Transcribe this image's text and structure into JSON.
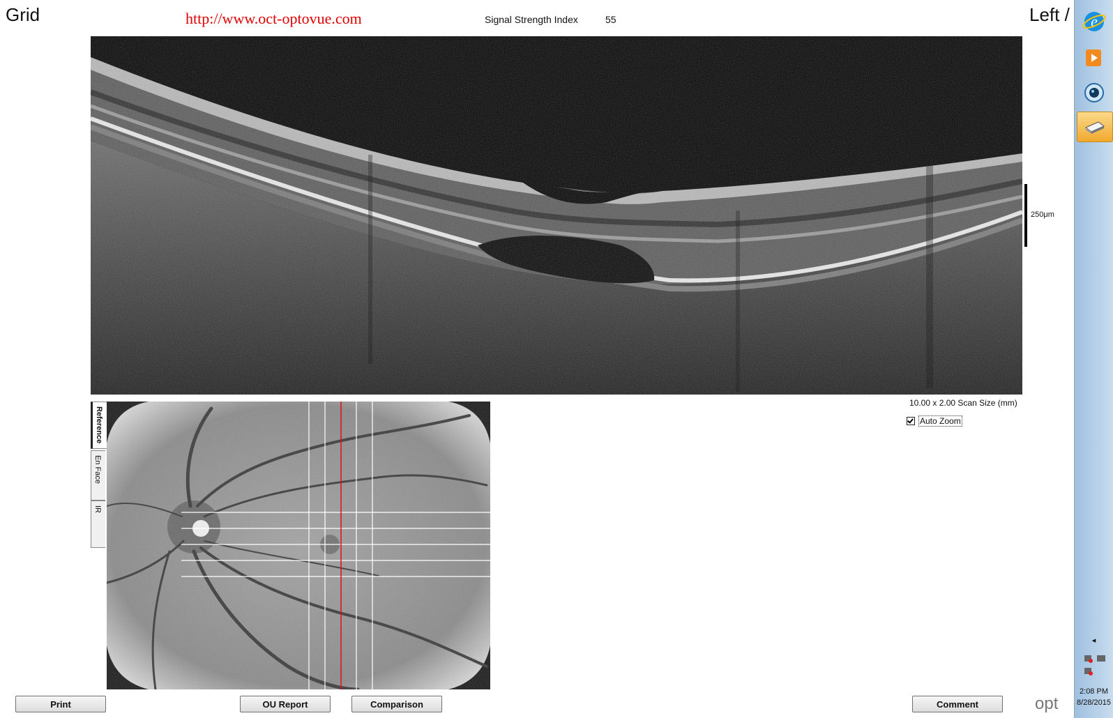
{
  "header": {
    "scan_type": "Grid",
    "watermark_url": "http://www.oct-optovue.com",
    "signal_strength_label": "Signal Strength Index",
    "signal_strength_value": "55",
    "eye": "Left /"
  },
  "bscan": {
    "scale_label": "250μm",
    "scan_size": "10.00 x 2.00 Scan Size (mm)"
  },
  "options": {
    "auto_zoom_label": "Auto Zoom",
    "auto_zoom_checked": true
  },
  "tabs": [
    {
      "label": "Reference",
      "active": true
    },
    {
      "label": "En Face",
      "active": false
    },
    {
      "label": "IR",
      "active": false
    }
  ],
  "buttons": {
    "print": "Print",
    "ou_report": "OU Report",
    "comparison": "Comparison",
    "comment": "Comment"
  },
  "logo_text": "opt",
  "taskbar": {
    "icons": [
      "internet-explorer-icon",
      "media-player-icon",
      "camera-icon",
      "scanner-icon"
    ],
    "time": "2:08 PM",
    "date": "8/28/2015"
  },
  "colors": {
    "url_red": "#e00000",
    "scan_line_red": "#e01010",
    "taskbar_selected": "#f0a92e"
  }
}
